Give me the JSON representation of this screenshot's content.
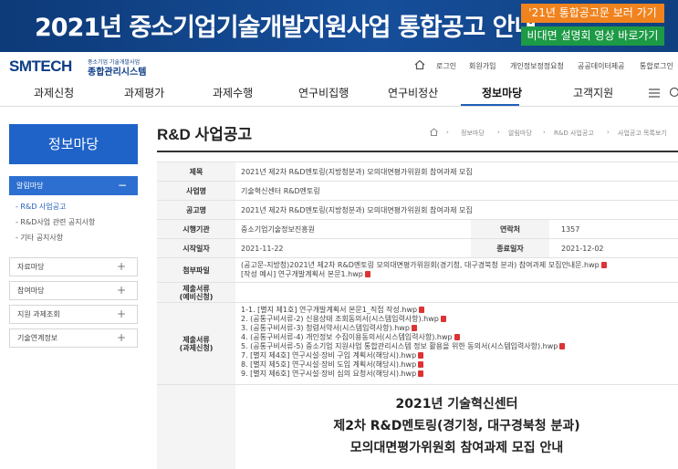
{
  "banner": {
    "title": "2021년 중소기업기술개발지원사업 통합공고 안내",
    "btn_notice": "'21년 통합공고문 보러 가기",
    "btn_video": "비대면 설명회 영상 바로가기"
  },
  "header": {
    "logo_main": "SMTECH",
    "logo_sub1": "중소기업 기술개발사업",
    "logo_sub2": "종합관리시스템",
    "util": [
      "로그인",
      "회원가입",
      "개인정보정정요청",
      "공공데이터제공",
      "통합로그인"
    ]
  },
  "gnb": [
    "과제신청",
    "과제평가",
    "과제수행",
    "연구비집행",
    "연구비정산",
    "정보마당",
    "고객지원"
  ],
  "sidebar": {
    "title": "정보마당",
    "group_head": "알림마당",
    "links": [
      "- R&D 사업공고",
      "- R&D사업 관련 공지사항",
      "- 기타 공지사항"
    ],
    "boxes": [
      "자료마당",
      "참여마당",
      "지원 과제조회",
      "기술연계정보"
    ]
  },
  "content": {
    "page_title": "R&D 사업공고",
    "breadcrumb": [
      "정보마당",
      "알림마당",
      "R&D 사업공고",
      "사업공고 목록보기"
    ]
  },
  "detail": {
    "labels": {
      "title": "제목",
      "business": "사업명",
      "notice": "공고명",
      "org": "시행기관",
      "hits": "연락처",
      "start": "시작일자",
      "end": "종료일자",
      "attach": "첨부파일",
      "submit_pre": "제출서류\n(예비신청)",
      "submit": "제출서류\n(과제신청)"
    },
    "title": "2021년 제2차 R&D멘토링(지방청분과) 모의대면평가위원회 참여과제 모집",
    "business": "기술혁신센터 R&D멘토링",
    "notice": "2021년 제2차 R&D멘토링(지방청분과) 모의대면평가위원회 참여과제 모집",
    "org": "중소기업기술정보진흥원",
    "hits": "1357",
    "start": "2021-11-22",
    "end": "2021-12-02",
    "attachments": [
      "(공고문-지방청)2021년 제2차 R&D멘토링 모의대면평가위원회(경기청, 대구경북청 분과) 참여과제 모집안내문.hwp",
      "[작성 예시] 연구개발계획서 본문1.hwp"
    ],
    "submit_files": [
      "1-1. [별지 제1호] 연구개발계획서 본문1_직접 작성.hwp",
      "2. (공통구비서류-2) 신용상태 조회동의서(시스템입력사항).hwp",
      "3. (공통구비서류-3) 청렴서약서(시스템입력사항).hwp",
      "4. (공통구비서류-4) 개인정보 수집이용동의서(시스템입력사항).hwp",
      "5. (공통구비서류-5) 중소기업 지원사업 통합관리시스템 정보 활용을 위한 동의서(시스템입력사항).hwp",
      "7. [별지 제4호] 연구시설·장비 구입 계획서(해당시).hwp",
      "8. [별지 제5호] 연구시설·장비 도입 계획서(해당시).hwp",
      "9. [별지 제6호] 연구시설·장비 심의 요청서(해당시).hwp"
    ],
    "notice_lines": [
      "2021년 기술혁신센터",
      "제2차 R&D멘토링(경기청, 대구경북청 분과)",
      "모의대면평가위원회 참여과제 모집 안내"
    ]
  }
}
